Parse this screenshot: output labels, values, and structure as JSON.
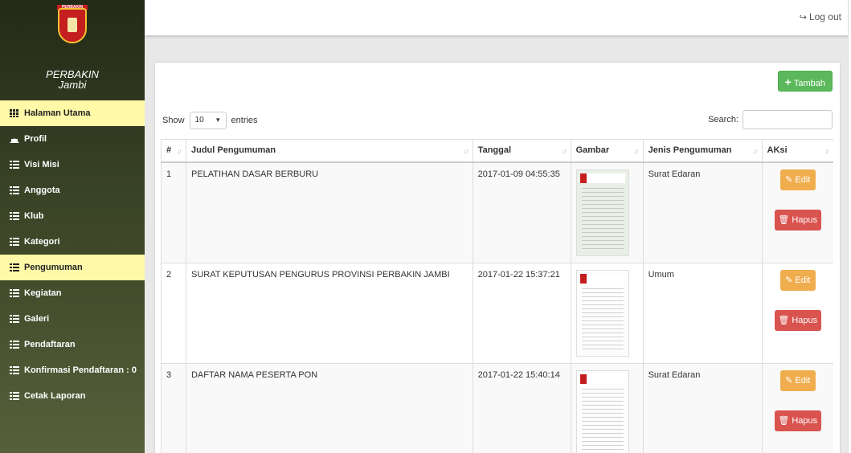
{
  "sidebar": {
    "logo_text": "PERBAKIN",
    "brand_line1": "PERBAKIN",
    "brand_line2": "Jambi",
    "items": [
      {
        "label": "Halaman Utama",
        "icon": "grid-icon",
        "active": true
      },
      {
        "label": "Profil",
        "icon": "home-icon",
        "active": false
      },
      {
        "label": "Visi Misi",
        "icon": "list-icon",
        "active": false
      },
      {
        "label": "Anggota",
        "icon": "list-icon",
        "active": false
      },
      {
        "label": "Klub",
        "icon": "list-icon",
        "active": false
      },
      {
        "label": "Kategori",
        "icon": "list-icon",
        "active": false
      },
      {
        "label": "Pengumuman",
        "icon": "list-icon",
        "active": true
      },
      {
        "label": "Kegiatan",
        "icon": "list-icon",
        "active": false
      },
      {
        "label": "Galeri",
        "icon": "list-icon",
        "active": false
      },
      {
        "label": "Pendaftaran",
        "icon": "list-icon",
        "active": false
      },
      {
        "label": "Konfirmasi Pendaftaran : 0",
        "icon": "list-icon",
        "active": false
      },
      {
        "label": "Cetak Laporan",
        "icon": "list-icon",
        "active": false
      }
    ]
  },
  "topbar": {
    "logout_label": "Log out"
  },
  "toolbar": {
    "add_label": "Tambah"
  },
  "table_controls": {
    "show_label": "Show",
    "page_size": "10",
    "entries_label": "entries",
    "search_label": "Search:",
    "search_value": ""
  },
  "table": {
    "headers": [
      "#",
      "Judul Pengumuman",
      "Tanggal",
      "Gambar",
      "Jenis Pengumuman",
      "AKsi"
    ],
    "rows": [
      {
        "no": "1",
        "judul": "PELATIHAN DASAR BERBURU",
        "tanggal": "2017-01-09 04:55:35",
        "jenis": "Surat Edaran",
        "edit": "Edit",
        "hapus": "Hapus"
      },
      {
        "no": "2",
        "judul": "SURAT KEPUTUSAN PENGURUS PROVINSI PERBAKIN JAMBI",
        "tanggal": "2017-01-22 15:37:21",
        "jenis": "Umum",
        "edit": "Edit",
        "hapus": "Hapus"
      },
      {
        "no": "3",
        "judul": "DAFTAR NAMA PESERTA PON",
        "tanggal": "2017-01-22 15:40:14",
        "jenis": "Surat Edaran",
        "edit": "Edit",
        "hapus": "Hapus"
      }
    ]
  },
  "colors": {
    "active_nav": "#fff9a8",
    "add_button": "#5cb85c",
    "edit_button": "#f0ad4e",
    "delete_button": "#d9534f"
  }
}
